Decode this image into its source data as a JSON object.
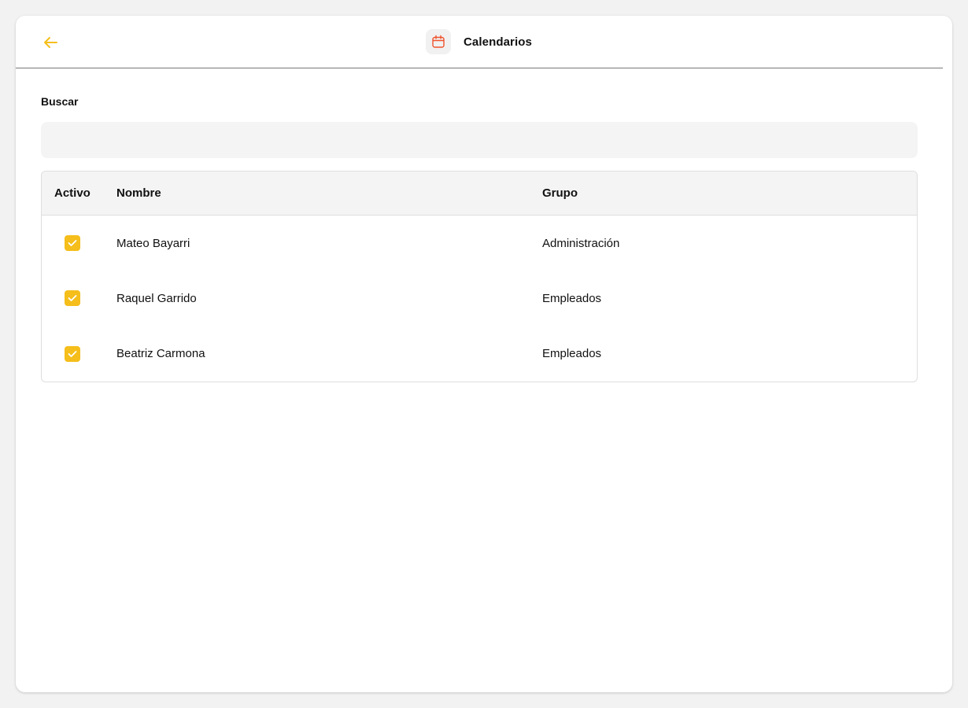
{
  "header": {
    "title": "Calendarios",
    "back_icon": "arrow-left-icon",
    "title_icon": "calendar-icon",
    "accent_color": "#f5be1b",
    "icon_color": "#f0522d"
  },
  "search": {
    "label": "Buscar",
    "value": "",
    "placeholder": ""
  },
  "table": {
    "columns": [
      "Activo",
      "Nombre",
      "Grupo"
    ],
    "rows": [
      {
        "activo": true,
        "nombre": "Mateo Bayarri",
        "grupo": "Administración"
      },
      {
        "activo": true,
        "nombre": "Raquel Garrido",
        "grupo": "Empleados"
      },
      {
        "activo": true,
        "nombre": "Beatriz Carmona",
        "grupo": "Empleados"
      }
    ]
  }
}
